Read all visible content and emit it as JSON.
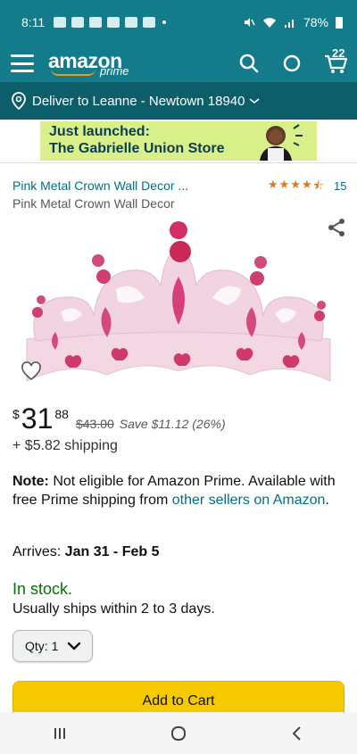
{
  "status_bar": {
    "time": "8:11",
    "battery": "78%"
  },
  "header": {
    "logo_text": "amazon",
    "logo_sub": "prime",
    "cart_count": "22"
  },
  "delivery": {
    "text": "Deliver to Leanne - Newtown 18940"
  },
  "banner": {
    "line1": "Just launched:",
    "line2": "The Gabrielle Union Store"
  },
  "product": {
    "title_link": "Pink Metal Crown Wall Decor ...",
    "title": "Pink Metal Crown Wall Decor",
    "rating_count": "15",
    "rating": 4.5
  },
  "price": {
    "currency": "$",
    "whole": "31",
    "fraction": "88",
    "list_price": "$43.00",
    "savings": "Save $11.12 (26%)",
    "shipping": "+ $5.82 shipping"
  },
  "note": {
    "label": "Note:",
    "text": " Not eligible for Amazon Prime. Available with free Prime shipping from ",
    "link": "other sellers on Amazon",
    "end": "."
  },
  "arrival": {
    "label": "Arrives: ",
    "dates": "Jan 31 - Feb 5"
  },
  "stock": {
    "status": "In stock.",
    "ships": "Usually ships within 2 to 3 days."
  },
  "quantity": {
    "label": "Qty:",
    "value": "1"
  },
  "buttons": {
    "add_to_cart": "Add to Cart"
  },
  "colors": {
    "header_teal": "#137b8a",
    "delivery_teal": "#0d5e6b",
    "link": "#007185",
    "in_stock": "#007600",
    "add_to_cart": "#f7ca00",
    "star": "#de7921"
  }
}
